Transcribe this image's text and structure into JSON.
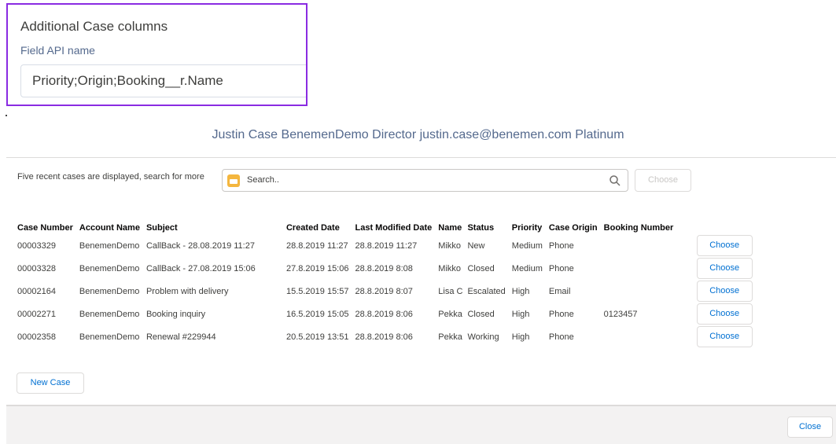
{
  "settings": {
    "title": "Additional Case columns",
    "field_label": "Field API name",
    "field_value": "Priority;Origin;Booking__r.Name"
  },
  "contact_header": "Justin Case BenemenDemo Director justin.case@benemen.com Platinum",
  "search": {
    "hint": "Five recent cases are displayed, search for more",
    "placeholder": "Search..",
    "choose_label": "Choose"
  },
  "table": {
    "columns": [
      "Case Number",
      "Account Name",
      "Subject",
      "Created Date",
      "Last Modified Date",
      "Name",
      "Status",
      "Priority",
      "Case Origin",
      "Booking Number"
    ],
    "choose_label": "Choose",
    "rows": [
      [
        "00003329",
        "BenemenDemo",
        "CallBack - 28.08.2019 11:27",
        "28.8.2019 11:27",
        "28.8.2019 11:27",
        "Mikko",
        "New",
        "Medium",
        "Phone",
        ""
      ],
      [
        "00003328",
        "BenemenDemo",
        "CallBack - 27.08.2019 15:06",
        "27.8.2019 15:06",
        "28.8.2019 8:08",
        "Mikko",
        "Closed",
        "Medium",
        "Phone",
        ""
      ],
      [
        "00002164",
        "BenemenDemo",
        "Problem with delivery",
        "15.5.2019 15:57",
        "28.8.2019 8:07",
        "Lisa C",
        "Escalated",
        "High",
        "Email",
        ""
      ],
      [
        "00002271",
        "BenemenDemo",
        "Booking inquiry",
        "16.5.2019 15:05",
        "28.8.2019 8:06",
        "Pekka",
        "Closed",
        "High",
        "Phone",
        "0123457"
      ],
      [
        "00002358",
        "BenemenDemo",
        "Renewal #229944",
        "20.5.2019 13:51",
        "28.8.2019 8:06",
        "Pekka",
        "Working",
        "High",
        "Phone",
        ""
      ]
    ]
  },
  "new_case_label": "New Case",
  "close_label": "Close",
  "icons": {
    "folder": "folder-icon",
    "search": "search-icon"
  },
  "colors": {
    "highlight_border": "#8a2be2",
    "link_blue": "#0070d2",
    "folder_yellow": "#f4b63e"
  }
}
